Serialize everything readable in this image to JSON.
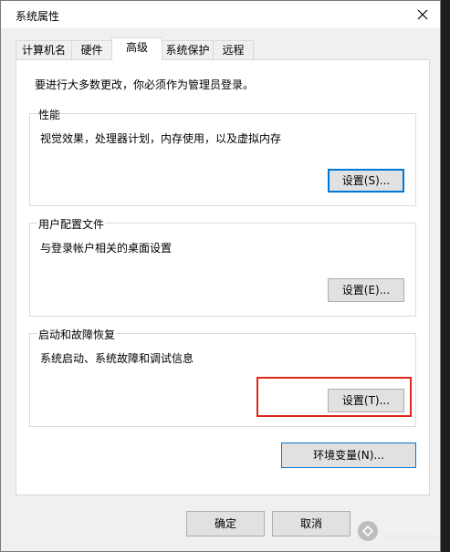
{
  "window": {
    "title": "系统属性"
  },
  "tabs": [
    {
      "label": "计算机名"
    },
    {
      "label": "硬件"
    },
    {
      "label": "高级"
    },
    {
      "label": "系统保护"
    },
    {
      "label": "远程"
    }
  ],
  "panel": {
    "note": "要进行大多数更改，你必须作为管理员登录。",
    "performance": {
      "title": "性能",
      "desc": "视觉效果，处理器计划，内存使用，以及虚拟内存",
      "button": "设置(S)..."
    },
    "profiles": {
      "title": "用户配置文件",
      "desc": "与登录帐户相关的桌面设置",
      "button": "设置(E)..."
    },
    "startup": {
      "title": "启动和故障恢复",
      "desc": "系统启动、系统故障和调试信息",
      "button": "设置(T)..."
    },
    "env_button": "环境变量(N)..."
  },
  "footer": {
    "ok": "确定",
    "cancel": "取消"
  },
  "watermark": {
    "cn": "创新互联",
    "en": "CHUANG XIN HU LIAN"
  },
  "colors": {
    "highlight": "#e0261c",
    "focus": "#0078d7"
  },
  "icons": {
    "close": "close-icon",
    "watermark": "logo-icon"
  }
}
